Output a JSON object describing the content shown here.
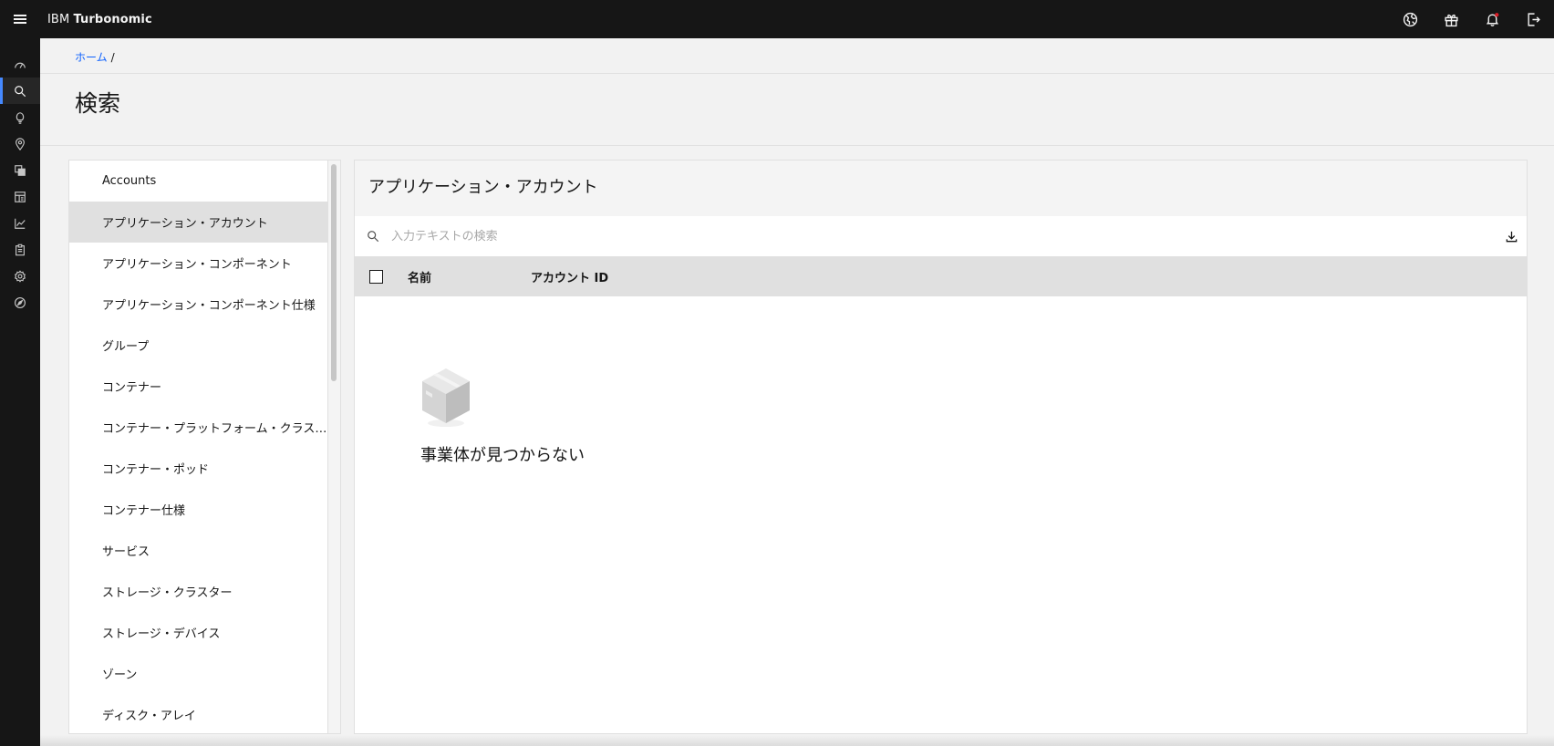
{
  "header": {
    "brand_prefix": "IBM",
    "brand_name": "Turbonomic",
    "actions": [
      {
        "icon": "globe-icon"
      },
      {
        "icon": "gift-icon"
      },
      {
        "icon": "notification-icon",
        "badge_color": "#da1e28"
      },
      {
        "icon": "logout-icon"
      }
    ]
  },
  "rail": {
    "items": [
      {
        "icon": "dashboard-icon",
        "active": false
      },
      {
        "icon": "search-icon",
        "active": true
      },
      {
        "icon": "lightbulb-icon",
        "active": false
      },
      {
        "icon": "location-icon",
        "active": false
      },
      {
        "icon": "copy-icon",
        "active": false
      },
      {
        "icon": "table-split-icon",
        "active": false
      },
      {
        "icon": "chart-line-icon",
        "active": false
      },
      {
        "icon": "clipboard-icon",
        "active": false
      },
      {
        "icon": "settings-icon",
        "active": false
      },
      {
        "icon": "compass-icon",
        "active": false
      }
    ],
    "accent_color": "#4589ff"
  },
  "breadcrumb": {
    "home": "ホーム",
    "separator": "/"
  },
  "page": {
    "title": "検索"
  },
  "entity_list": {
    "items": [
      {
        "label": "Accounts",
        "selected": false
      },
      {
        "label": "アプリケーション・アカウント",
        "selected": true
      },
      {
        "label": "アプリケーション・コンポーネント",
        "selected": false
      },
      {
        "label": "アプリケーション・コンポーネント仕様",
        "selected": false
      },
      {
        "label": "グループ",
        "selected": false
      },
      {
        "label": "コンテナー",
        "selected": false
      },
      {
        "label": "コンテナー・プラットフォーム・クラス…",
        "selected": false
      },
      {
        "label": "コンテナー・ポッド",
        "selected": false
      },
      {
        "label": "コンテナー仕様",
        "selected": false
      },
      {
        "label": "サービス",
        "selected": false
      },
      {
        "label": "ストレージ・クラスター",
        "selected": false
      },
      {
        "label": "ストレージ・デバイス",
        "selected": false
      },
      {
        "label": "ゾーン",
        "selected": false
      },
      {
        "label": "ディスク・アレイ",
        "selected": false
      }
    ]
  },
  "main": {
    "title": "アプリケーション・アカウント",
    "search": {
      "placeholder": "入力テキストの検索",
      "value": ""
    },
    "table": {
      "columns": [
        "名前",
        "アカウント ID"
      ],
      "rows": []
    },
    "empty_state": {
      "icon": "empty-box-icon",
      "message": "事業体が見つからない"
    }
  }
}
